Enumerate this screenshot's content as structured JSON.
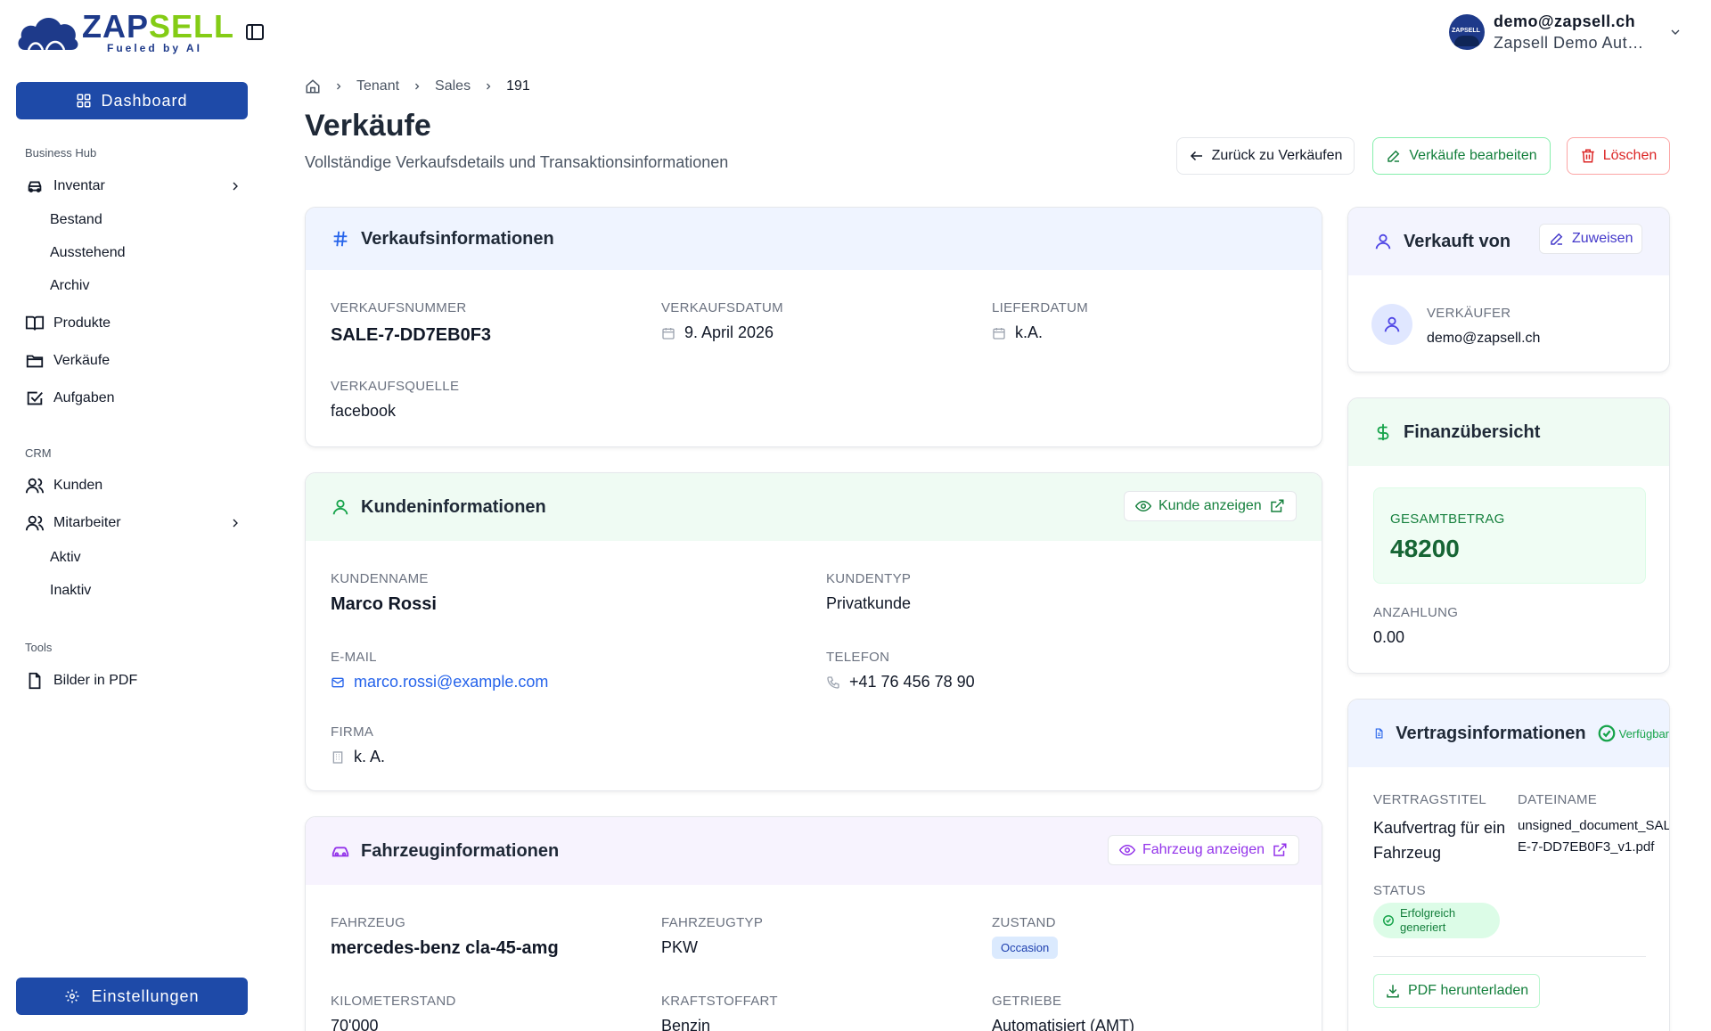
{
  "brand": {
    "logo_main_a": "ZAP",
    "logo_main_b": "SELL",
    "logo_sub": "Fueled by AI",
    "avatar_text": "ZAPSELL"
  },
  "user": {
    "email": "demo@zapsell.ch",
    "org": "Zapsell Demo Autohaus"
  },
  "sidebar": {
    "dashboard": "Dashboard",
    "settings": "Einstellungen",
    "sections": {
      "business": "Business Hub",
      "crm": "CRM",
      "tools": "Tools"
    },
    "inventar": "Inventar",
    "inventar_sub": [
      "Bestand",
      "Ausstehend",
      "Archiv"
    ],
    "produkte": "Produkte",
    "verkaeufe": "Verkäufe",
    "aufgaben": "Aufgaben",
    "kunden": "Kunden",
    "mitarbeiter": "Mitarbeiter",
    "mitarbeiter_sub": [
      "Aktiv",
      "Inaktiv"
    ],
    "bilder": "Bilder in PDF"
  },
  "breadcrumb": {
    "tenant": "Tenant",
    "sales": "Sales",
    "id": "191"
  },
  "page": {
    "title": "Verkäufe",
    "subtitle": "Vollständige Verkaufsdetails und Transaktionsinformationen",
    "back": "Zurück zu Verkäufen",
    "edit": "Verkäufe bearbeiten",
    "delete": "Löschen"
  },
  "sale": {
    "title": "Verkaufsinformationen",
    "number_label": "VERKAUFSNUMMER",
    "number": "SALE-7-DD7EB0F3",
    "date_label": "VERKAUFSDATUM",
    "date": "9. April 2026",
    "delivery_label": "LIEFERDATUM",
    "delivery": "k.A.",
    "source_label": "VERKAUFSQUELLE",
    "source": "facebook"
  },
  "customer": {
    "title": "Kundeninformationen",
    "view": "Kunde anzeigen",
    "name_label": "KUNDENNAME",
    "name": "Marco Rossi",
    "type_label": "KUNDENTYP",
    "type": "Privatkunde",
    "email_label": "E-MAIL",
    "email": "marco.rossi@example.com",
    "phone_label": "TELEFON",
    "phone": "+41 76 456 78 90",
    "company_label": "FIRMA",
    "company": "k. A."
  },
  "vehicle": {
    "title": "Fahrzeuginformationen",
    "view": "Fahrzeug anzeigen",
    "vehicle_label": "FAHRZEUG",
    "vehicle": "mercedes-benz cla-45-amg",
    "type_label": "FAHRZEUGTYP",
    "type": "PKW",
    "condition_label": "ZUSTAND",
    "condition": "Occasion",
    "km_label": "KILOMETERSTAND",
    "km": "70'000",
    "fuel_label": "KRAFTSTOFFART",
    "fuel": "Benzin",
    "gear_label": "GETRIEBE",
    "gear": "Automatisiert (AMT)"
  },
  "seller": {
    "title": "Verkauft von",
    "assign": "Zuweisen",
    "label": "VERKÄUFER",
    "email": "demo@zapsell.ch"
  },
  "finance": {
    "title": "Finanzübersicht",
    "total_label": "GESAMTBETRAG",
    "total": "48200",
    "deposit_label": "ANZAHLUNG",
    "deposit": "0.00"
  },
  "contract": {
    "title": "Vertragsinformationen",
    "available": "Verfügbar",
    "title_label": "VERTRAGSTITEL",
    "contract_title": "Kaufvertrag für ein Fahrzeug",
    "file_label": "DATEINAME",
    "file": "unsigned_document_SALE-7-DD7EB0F3_v1.pdf",
    "status_label": "STATUS",
    "status": "Erfolgreich generiert",
    "download": "PDF herunterladen"
  }
}
